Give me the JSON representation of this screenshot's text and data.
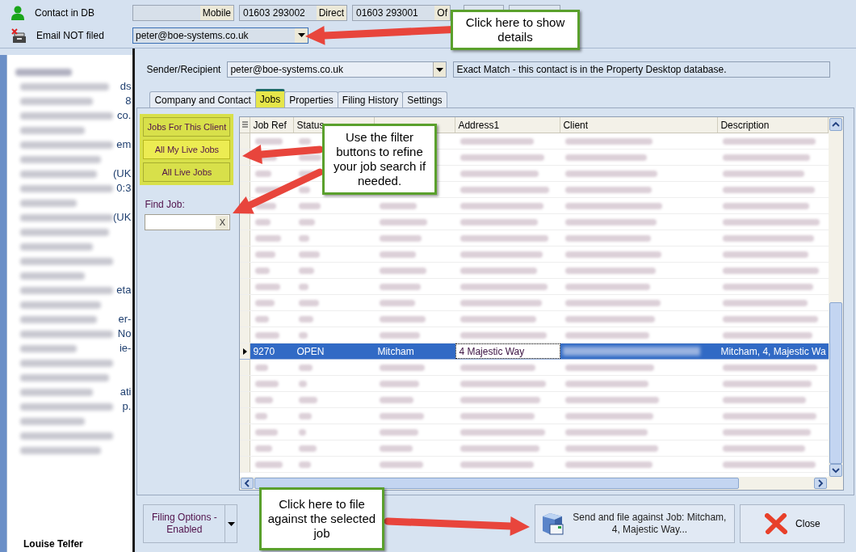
{
  "header": {
    "contact_status": "Contact in DB",
    "email_status": "Email NOT filed",
    "phones": [
      {
        "label": "Mobile"
      },
      {
        "number": "01603 293002",
        "label": "Direct"
      },
      {
        "number": "01603 293001",
        "label": "Of"
      }
    ],
    "email_select": "peter@boe-systems.co.uk"
  },
  "email_preview": {
    "lines": [
      {
        "kind": "fragment",
        "text": "ds"
      },
      {
        "kind": "fragment",
        "text": "8"
      },
      {
        "kind": "fragment",
        "text": "co."
      },
      {
        "kind": "blur"
      },
      {
        "kind": "fragment",
        "text": "em"
      },
      {
        "kind": "blur"
      },
      {
        "kind": "fragment",
        "text": "(UK"
      },
      {
        "kind": "fragment",
        "text": "0:3"
      },
      {
        "kind": "blur"
      },
      {
        "kind": "fragment",
        "text": "(UK"
      },
      {
        "kind": "blur"
      },
      {
        "kind": "blur"
      },
      {
        "kind": "blur"
      },
      {
        "kind": "blur"
      },
      {
        "kind": "fragment",
        "text": "eta"
      },
      {
        "kind": "blur"
      },
      {
        "kind": "fragment",
        "text": "er-"
      },
      {
        "kind": "fragment",
        "text": "No"
      },
      {
        "kind": "fragment",
        "text": "ie-"
      },
      {
        "kind": "blur"
      },
      {
        "kind": "blur"
      },
      {
        "kind": "fragment",
        "text": "ati"
      },
      {
        "kind": "fragment",
        "text": "p."
      },
      {
        "kind": "blur"
      },
      {
        "kind": "blur"
      },
      {
        "kind": "blur"
      }
    ],
    "signature": "Louise Telfer"
  },
  "dialog": {
    "sender_label": "Sender/Recipient",
    "sender_value": "peter@boe-systems.co.uk",
    "match_info": "Exact Match - this contact is in the Property Desktop database.",
    "tabs": [
      {
        "label": "Company and Contact",
        "selected": false
      },
      {
        "label": "Jobs",
        "selected": true
      },
      {
        "label": "Properties",
        "selected": false
      },
      {
        "label": "Filing History",
        "selected": false
      },
      {
        "label": "Settings",
        "selected": false
      }
    ],
    "filters": [
      {
        "label": "Jobs For This Client",
        "selected": false
      },
      {
        "label": "All My Live Jobs",
        "selected": true
      },
      {
        "label": "All Live Jobs",
        "selected": false
      }
    ],
    "find_label": "Find Job:",
    "find_clear": "X",
    "table": {
      "columns": [
        "Job Ref",
        "Status",
        "",
        "Address1",
        "Client",
        "Description"
      ],
      "rows": [
        {
          "kind": "blurred",
          "selected": false
        },
        {
          "kind": "blurred",
          "selected": false
        },
        {
          "kind": "blurred",
          "selected": false
        },
        {
          "kind": "blurred",
          "selected": false
        },
        {
          "kind": "blurred",
          "selected": false
        },
        {
          "kind": "blurred",
          "selected": false
        },
        {
          "kind": "blurred",
          "selected": false
        },
        {
          "kind": "blurred",
          "selected": false
        },
        {
          "kind": "blurred",
          "selected": false
        },
        {
          "kind": "blurred",
          "selected": false
        },
        {
          "kind": "blurred",
          "selected": false
        },
        {
          "kind": "blurred",
          "selected": false
        },
        {
          "kind": "blurred",
          "selected": false
        },
        {
          "kind": "data",
          "selected": true,
          "cells": [
            {
              "text": "9270"
            },
            {
              "text": "OPEN"
            },
            {
              "text": "Mitcham"
            },
            {
              "text": "4 Majestic Way",
              "focused": true
            },
            {
              "kind": "blurred"
            },
            {
              "text": "Mitcham, 4, Majestic Wa"
            }
          ]
        },
        {
          "kind": "blurred",
          "selected": false
        },
        {
          "kind": "blurred",
          "selected": false
        },
        {
          "kind": "blurred",
          "selected": false
        },
        {
          "kind": "blurred",
          "selected": false
        },
        {
          "kind": "blurred",
          "selected": false
        },
        {
          "kind": "blurred",
          "selected": false
        },
        {
          "kind": "blurred",
          "selected": false
        }
      ]
    },
    "filing_options": "Filing Options - Enabled",
    "send_button": "Send and file against Job:  Mitcham, 4, Majestic Way...",
    "close_button": "Close"
  },
  "callouts": [
    {
      "text": "Click here to show details"
    },
    {
      "text": "Use the filter buttons to refine your job search if needed."
    },
    {
      "text": "Click here to file against the selected job"
    }
  ]
}
